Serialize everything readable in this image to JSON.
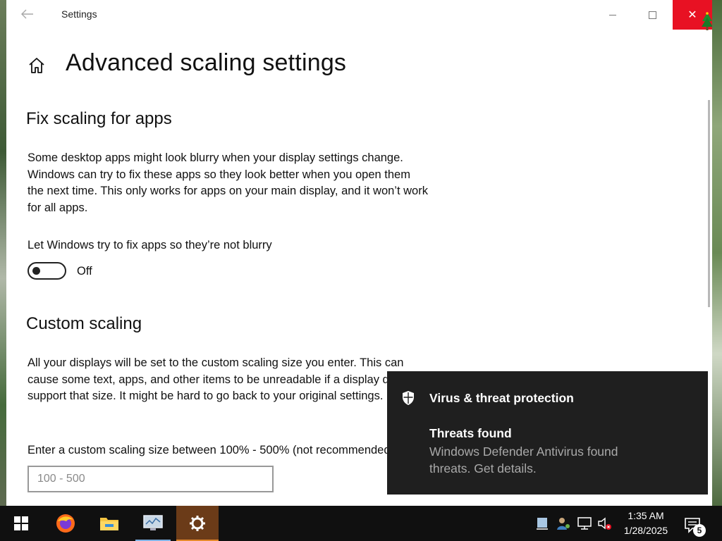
{
  "window": {
    "app_title": "Settings",
    "page_title": "Advanced scaling settings",
    "close_color": "#e81123"
  },
  "fix_scaling": {
    "title": "Fix scaling for apps",
    "description": "Some desktop apps might look blurry when your display settings change. Windows can try to fix these apps so they look better when you open them the next time. This only works for apps on your main display, and it won’t work for all apps.",
    "toggle_label": "Let Windows try to fix apps so they’re not blurry",
    "toggle_state": "Off",
    "toggle_on": false
  },
  "custom_scaling": {
    "title": "Custom scaling",
    "description": "All your displays will be set to the custom scaling size you enter. This can cause some text, apps, and other items to be unreadable if a display doesn't support that size. It might be hard to go back to your original settings.",
    "input_label": "Enter a custom scaling size between 100% - 500% (not recommended)",
    "input_value": "",
    "input_placeholder": "100 - 500"
  },
  "toast": {
    "app_name": "Virus & threat protection",
    "heading": "Threats found",
    "body": "Windows Defender Antivirus found threats. Get details.",
    "icon": "shield-icon"
  },
  "taskbar": {
    "apps": [
      "start",
      "firefox",
      "file-explorer",
      "system-monitor",
      "settings"
    ],
    "clock_time": "1:35 AM",
    "clock_date": "1/28/2025",
    "notification_count": "5",
    "active_color": "#e58a2b"
  }
}
